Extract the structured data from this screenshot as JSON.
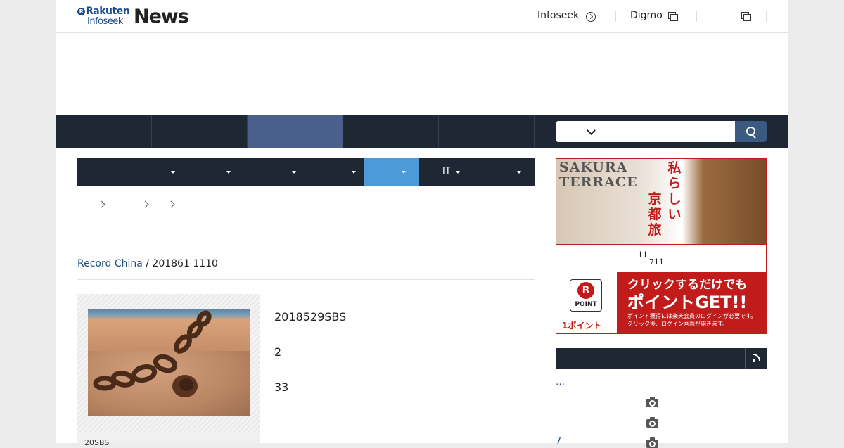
{
  "header": {
    "logo_rakuten": "Rakuten",
    "logo_infoseek": "Infoseek",
    "logo_news": "News",
    "link_infoseek": "Infoseek",
    "link_digmo": "Digmo"
  },
  "subnav": {
    "it_label": "IT"
  },
  "article": {
    "publisher": "Record China",
    "dateline": " / 201861 1110",
    "para1": "2018529SBS",
    "para2": "2",
    "para3": "33",
    "caption": "20SBS"
  },
  "ad": {
    "sakura_line1": "SAKURA",
    "sakura_line2": "TERRACE",
    "jp_vertical_1": "私らしい",
    "jp_vertical_2": "京都旅",
    "num1": "11",
    "num2": "711",
    "point_label": "POINT",
    "one_point": "1ポイント",
    "click_line1": "クリックするだけでも",
    "click_line2": "ポイントGET!!",
    "note1": "ポイント獲得には楽天会員のログインが必要です。",
    "note2": "クリック後、ログイン画面が開きます。"
  },
  "ranking": {
    "item1": "…",
    "item3_prefix": "7"
  },
  "colors": {
    "nav_dark": "#1e2733",
    "nav_active": "#4a5f8c",
    "subnav_active": "#4d9ad9",
    "link_blue": "#1e4e82",
    "ad_red": "#c21b1b"
  }
}
